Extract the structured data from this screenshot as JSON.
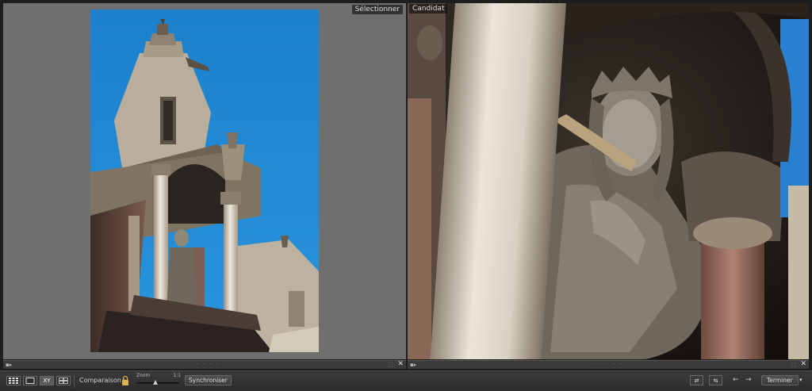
{
  "panels": {
    "left": {
      "tag": "Sélectionner"
    },
    "right": {
      "tag": "Candidat"
    }
  },
  "panel_footer": {
    "left_icon": "▪▸",
    "right_icon": "▪▸",
    "dots": "· · · · ·",
    "stars": "⬚",
    "close": "✕"
  },
  "toolbar": {
    "grid_view": "grid-view-icon",
    "loupe_view": "loupe-view-icon",
    "compare_view_glyph": "XY",
    "survey_view": "survey-view-icon",
    "compare_label": "Comparaison :",
    "zoom_label": "Zoom",
    "zoom_scale": "1:1",
    "zoom_level": 0.45,
    "sync_label": "Synchroniser",
    "swap_glyph": "⇄",
    "promote_glyph": "⇆",
    "prev_glyph": "←",
    "next_glyph": "→",
    "done_label": "Terminer",
    "menu_glyph": "▾"
  },
  "colors": {
    "sky": "#1a86d2",
    "panel_bg": "#6f6f6f",
    "stone": "#c9bfae",
    "toolbar": "#333333"
  }
}
